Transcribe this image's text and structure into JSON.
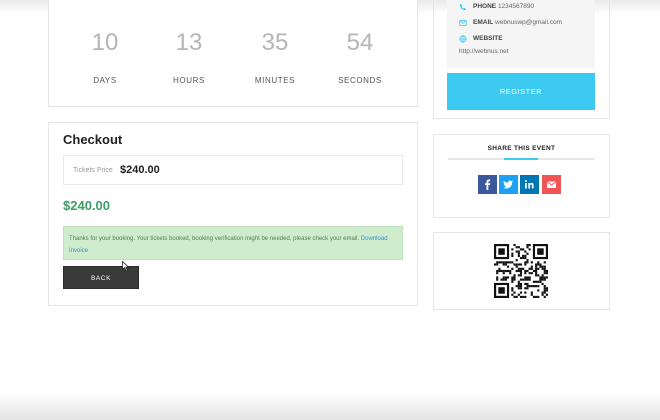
{
  "countdown": {
    "units": [
      {
        "value": "10",
        "label": "DAYS"
      },
      {
        "value": "13",
        "label": "HOURS"
      },
      {
        "value": "35",
        "label": "MINUTES"
      },
      {
        "value": "54",
        "label": "SECONDS"
      }
    ]
  },
  "checkout": {
    "title": "Checkout",
    "price_label": "Tickets Price",
    "price_value": "$240.00",
    "total": "$240.00",
    "notice_text": "Thanks for your booking. Your tickets booked, booking verification might be needed, please check your email.",
    "notice_link": "Download Invoice",
    "back_label": "BACK"
  },
  "contact": {
    "phone_key": "PHONE",
    "phone_value": "1234567890",
    "email_key": "EMAIL",
    "email_value": "webnuswp@gmail.com",
    "website_key": "WEBSITE",
    "website_value": "http://webnus.net"
  },
  "register_label": "REGISTER",
  "share": {
    "title": "SHARE THIS EVENT",
    "buttons": [
      {
        "icon": "facebook-icon",
        "color": "#3b5998"
      },
      {
        "icon": "twitter-icon",
        "color": "#1da1f2"
      },
      {
        "icon": "linkedin-icon",
        "color": "#0077b5"
      },
      {
        "icon": "email-icon",
        "color": "#f05555"
      }
    ]
  },
  "colors": {
    "accent": "#3cc9f0",
    "success": "#3c9e62",
    "notice_bg": "#cfeccd",
    "back_bg": "#3a3a3a"
  }
}
